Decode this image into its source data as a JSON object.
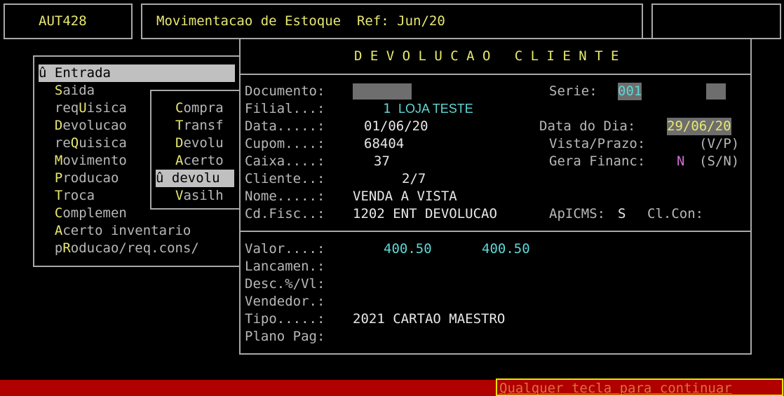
{
  "header": {
    "program_code": "AUT428",
    "title": "Movimentacao de Estoque  Ref: Jun/20"
  },
  "menu": {
    "items": [
      {
        "hot": "û ",
        "rest": "Entrada"
      },
      {
        "hot": "S",
        "rest": "aida"
      },
      {
        "pre": "req",
        "hot": "U",
        "rest": "isica"
      },
      {
        "hot": "D",
        "rest": "evolucao"
      },
      {
        "pre": "re",
        "hot": "Q",
        "rest": "uisica"
      },
      {
        "hot": "M",
        "rest": "ovimento"
      },
      {
        "hot": "P",
        "rest": "roducao"
      },
      {
        "hot": "T",
        "rest": "roca"
      },
      {
        "hot": "C",
        "rest": "omplemen"
      },
      {
        "hot": "A",
        "rest": "certo inventario"
      },
      {
        "pre": "p",
        "hot": "R",
        "rest": "oducao/req.cons/"
      }
    ]
  },
  "submenu": {
    "items": [
      {
        "hot": "C",
        "rest": "ompra"
      },
      {
        "hot": "T",
        "rest": "ransf"
      },
      {
        "hot": "D",
        "rest": "evolu"
      },
      {
        "hot": "A",
        "rest": "certo"
      },
      {
        "hot": "û ",
        "rest": "devolu"
      },
      {
        "hot": "V",
        "rest": "asilh"
      }
    ]
  },
  "dialog": {
    "title": "D E V O L U C A O   C L I E N T E",
    "labels": {
      "documento": "Documento:",
      "serie": "Serie:",
      "filial": "Filial...:",
      "data": "Data.....:",
      "data_dia": "Data do Dia:",
      "cupom": "Cupom....:",
      "vista_prazo": "Vista/Prazo:",
      "caixa": "Caixa....:",
      "gera_financ": "Gera Financ:",
      "cliente": "Cliente..:",
      "nome": "Nome.....:",
      "cd_fisc": "Cd.Fisc..:",
      "apicms": "ApICMS:",
      "cl_con": "Cl.Con:",
      "valor": "Valor....:",
      "lancamen": "Lancamen.:",
      "desc": "Desc.%/Vl:",
      "vendedor": "Vendedor.:",
      "tipo": "Tipo.....:",
      "plano_pag": "Plano Pag:"
    },
    "values": {
      "serie": "001",
      "filial_code": "1",
      "filial_name": "LOJA TESTE",
      "data": "01/06/20",
      "data_dia": "29/06/20",
      "cupom": "68404",
      "vista_prazo_hint": "(V/P)",
      "caixa": "37",
      "gera_financ": "N",
      "gera_financ_hint": "(S/N)",
      "cliente": "2/7",
      "nome": "VENDA A VISTA",
      "cd_fisc": "1202 ENT DEVOLUCAO",
      "apicms": "S",
      "valor1": "400.50",
      "valor2": "400.50",
      "tipo": "2021 CARTAO MAESTRO"
    }
  },
  "status": {
    "message": "Qualquer tecla para continuar"
  }
}
